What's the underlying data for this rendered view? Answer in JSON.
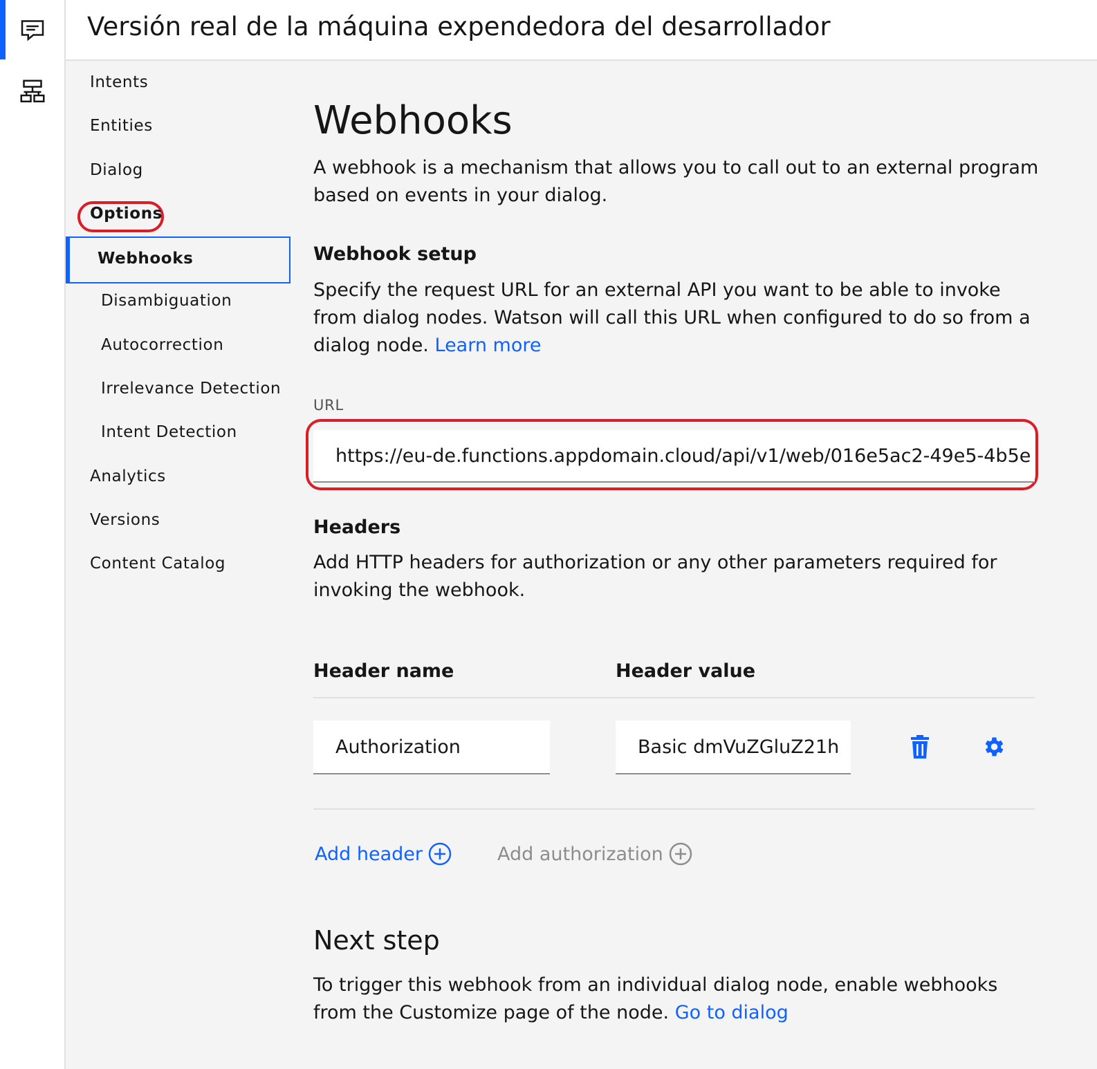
{
  "rail": {
    "items": [
      {
        "icon": "chat-icon",
        "active": true
      },
      {
        "icon": "dialog-tree-icon",
        "active": false
      }
    ]
  },
  "header": {
    "title": "Versión real de la máquina expendedora del desarrollador"
  },
  "sidenav": {
    "intents": "Intents",
    "entities": "Entities",
    "dialog": "Dialog",
    "options": "Options",
    "webhooks": "Webhooks",
    "disambiguation": "Disambiguation",
    "autocorrection": "Autocorrection",
    "irrelevance": "Irrelevance Detection",
    "intent_detection": "Intent Detection",
    "analytics": "Analytics",
    "versions": "Versions",
    "content_catalog": "Content Catalog"
  },
  "main": {
    "title": "Webhooks",
    "intro": "A webhook is a mechanism that allows you to call out to an external program based on events in your dialog.",
    "setup_title": "Webhook setup",
    "setup_text": "Specify the request URL for an external API you want to be able to invoke from dialog nodes. Watson will call this URL when configured to do so from a dialog node.",
    "learn_more": "Learn more",
    "url_label": "URL",
    "url_value": "https://eu-de.functions.appdomain.cloud/api/v1/web/016e5ac2-49e5-4b5e",
    "headers_title": "Headers",
    "headers_text": "Add HTTP headers for authorization or any other parameters required for invoking the webhook.",
    "col_name": "Header name",
    "col_value": "Header value",
    "rows": [
      {
        "name": "Authorization",
        "value": "Basic dmVuZGluZ21h"
      }
    ],
    "add_header": "Add header",
    "add_authorization": "Add authorization",
    "next_title": "Next step",
    "next_text": "To trigger this webhook from an individual dialog node, enable webhooks from the Customize page of the node.",
    "go_to_dialog": "Go to dialog"
  },
  "colors": {
    "accent": "#0f62fe",
    "highlight": "#da1e28",
    "disabled": "#8d8d8d"
  }
}
